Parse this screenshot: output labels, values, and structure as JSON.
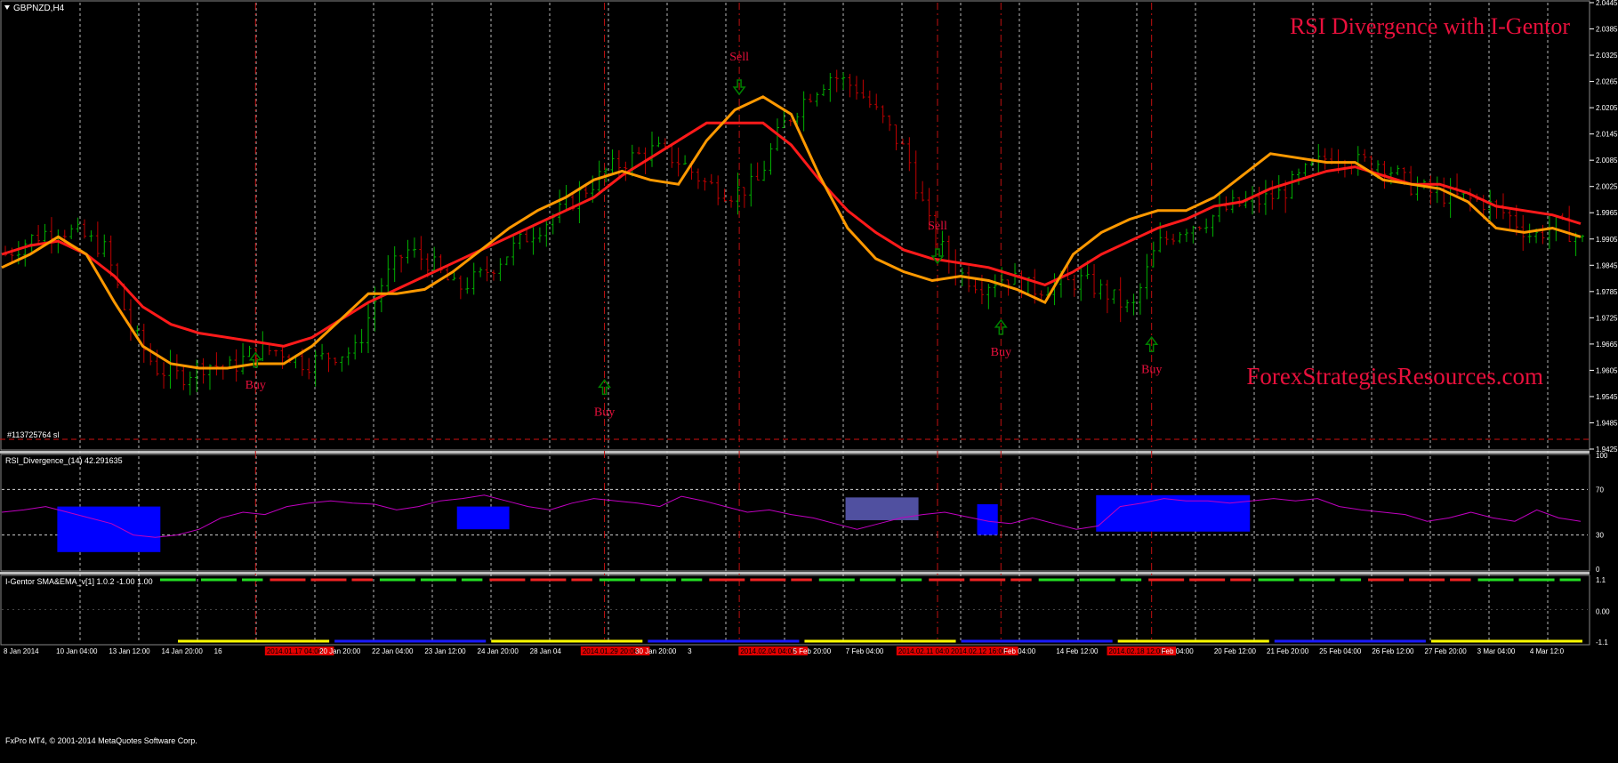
{
  "window": {
    "symbol_title": "GBPNZD,H4",
    "order_label": "#113725764 sl",
    "footer": "FxPro MT4, © 2001-2014 MetaQuotes Software Corp."
  },
  "overlay": {
    "title": "RSI Divergence with I-Gentor",
    "watermark": "ForexStrategiesResources.com"
  },
  "colors": {
    "background": "#000000",
    "bull_bar": "#00b000",
    "bear_bar": "#c00000",
    "fast_ma": "#ff9900",
    "slow_ma": "#ff1a1a",
    "rsi_line": "#c000c0",
    "signal_text": "#e8103c",
    "buy_arrow": "#008000",
    "divergence_box": "#0000ff",
    "selected_box": "#5050a0",
    "gentor_up": "#22dd22",
    "gentor_down": "#ee2222",
    "gentor_neutral": "#ffff00",
    "gentor_blue": "#1a1aff"
  },
  "chart_data": [
    {
      "type": "candlestick",
      "title": "GBPNZD,H4",
      "ylim": [
        1.9425,
        2.0445
      ],
      "y_ticks": [
        "2.0445",
        "2.0385",
        "2.0325",
        "2.0265",
        "2.0205",
        "2.0145",
        "2.0085",
        "2.0025",
        "1.9965",
        "1.9905",
        "1.9845",
        "1.9785",
        "1.9725",
        "1.9665",
        "1.9605",
        "1.9545",
        "1.9485",
        "1.9425"
      ],
      "x_ticks": [
        "8 Jan 2014",
        "10 Jan 04:00",
        "13 Jan 12:00",
        "14 Jan 20:00",
        "16",
        "2014.01.17 04:00",
        "20 Jan 20:00",
        "22 Jan 04:00",
        "23 Jan 12:00",
        "24 Jan 20:00",
        "28 Jan 04",
        "2014.01.29 20:00",
        "30 Jan 20:00",
        "3",
        "2014.02.04 04:00",
        "5 Feb 20:00",
        "7 Feb 04:00",
        "2014.02.11 04:00",
        "2014.02.12 16:00",
        "Feb 04:00",
        "14 Feb 12:00",
        "2014.02.18 12:00",
        "Feb 04:00",
        "20 Feb 12:00",
        "21 Feb 20:00",
        "25 Feb 04:00",
        "26 Feb 12:00",
        "27 Feb 20:00",
        "3 Mar 04:00",
        "4 Mar 12:0"
      ],
      "highlighted_x_ticks": [
        5,
        11,
        14,
        17,
        18,
        21
      ],
      "series": [
        {
          "name": "price",
          "values": [
            1.987,
            1.9905,
            1.993,
            1.9915,
            1.988,
            1.97,
            1.961,
            1.959,
            1.962,
            1.961,
            1.965,
            1.965,
            1.962,
            1.964,
            1.965,
            1.98,
            1.988,
            1.985,
            1.979,
            1.982,
            1.987,
            1.992,
            1.996,
            2.001,
            2.006,
            2.009,
            2.011,
            2.008,
            2.003,
            2.001,
            2.003,
            2.016,
            2.023,
            2.028,
            2.025,
            2.018,
            2.01,
            1.992,
            1.983,
            1.98,
            1.982,
            1.979,
            1.98,
            1.981,
            1.978,
            1.974,
            1.989,
            1.993,
            1.995,
            1.998,
            1.999,
            2.001,
            2.006,
            2.01,
            2.008,
            2.008,
            2.003,
            2.001,
            2.0,
            1.999,
            1.996,
            1.991,
            1.994,
            1.99
          ]
        },
        {
          "name": "ma_fast",
          "values": [
            1.984,
            1.987,
            1.991,
            1.987,
            1.976,
            1.966,
            1.962,
            1.961,
            1.961,
            1.962,
            1.962,
            1.966,
            1.972,
            1.978,
            1.978,
            1.979,
            1.983,
            1.988,
            1.993,
            1.997,
            2.0,
            2.004,
            2.006,
            2.004,
            2.003,
            2.013,
            2.02,
            2.023,
            2.019,
            2.005,
            1.993,
            1.986,
            1.983,
            1.981,
            1.982,
            1.981,
            1.979,
            1.976,
            1.987,
            1.992,
            1.995,
            1.997,
            1.997,
            2.0,
            2.005,
            2.01,
            2.009,
            2.008,
            2.008,
            2.004,
            2.003,
            2.002,
            1.999,
            1.993,
            1.992,
            1.993,
            1.991
          ]
        },
        {
          "name": "ma_slow",
          "values": [
            1.987,
            1.989,
            1.99,
            1.987,
            1.982,
            1.975,
            1.971,
            1.969,
            1.968,
            1.967,
            1.966,
            1.968,
            1.972,
            1.976,
            1.979,
            1.982,
            1.985,
            1.988,
            1.991,
            1.994,
            1.997,
            2.0,
            2.005,
            2.009,
            2.013,
            2.017,
            2.017,
            2.017,
            2.012,
            2.004,
            1.997,
            1.992,
            1.988,
            1.986,
            1.985,
            1.984,
            1.982,
            1.98,
            1.983,
            1.987,
            1.99,
            1.993,
            1.995,
            1.998,
            1.999,
            2.002,
            2.004,
            2.006,
            2.007,
            2.005,
            2.003,
            2.003,
            2.001,
            1.998,
            1.997,
            1.996,
            1.994
          ]
        }
      ],
      "signals": [
        {
          "label": "Buy",
          "x_frac": 0.16
        },
        {
          "label": "Buy",
          "x_frac": 0.38
        },
        {
          "label": "Sell",
          "x_frac": 0.465
        },
        {
          "label": "Sell",
          "x_frac": 0.59
        },
        {
          "label": "Buy",
          "x_frac": 0.63
        },
        {
          "label": "Buy",
          "x_frac": 0.725
        }
      ]
    },
    {
      "type": "line",
      "title": "RSI_Divergence_(14) 42.291635",
      "ylim": [
        0,
        100
      ],
      "y_ticks": [
        "100",
        "70",
        "30",
        "0"
      ],
      "levels": [
        70,
        30
      ],
      "series": [
        {
          "name": "RSI",
          "values": [
            50,
            52,
            55,
            50,
            45,
            40,
            30,
            28,
            30,
            35,
            45,
            50,
            48,
            55,
            58,
            60,
            58,
            57,
            52,
            55,
            60,
            62,
            65,
            60,
            55,
            52,
            58,
            62,
            60,
            58,
            55,
            64,
            60,
            55,
            50,
            52,
            48,
            45,
            40,
            35,
            40,
            45,
            48,
            50,
            46,
            42,
            40,
            45,
            40,
            35,
            38,
            55,
            58,
            62,
            60,
            60,
            58,
            60,
            62,
            60,
            62,
            55,
            52,
            50,
            48,
            42,
            45,
            50,
            45,
            42,
            52,
            45,
            42
          ]
        }
      ],
      "divergence_zones": [
        {
          "from": 0.035,
          "to": 0.1,
          "low": 15,
          "high": 55
        },
        {
          "from": 0.287,
          "to": 0.32,
          "low": 35,
          "high": 55
        },
        {
          "from": 0.532,
          "to": 0.578,
          "low": 43,
          "high": 63
        },
        {
          "from": 0.615,
          "to": 0.628,
          "low": 30,
          "high": 57
        },
        {
          "from": 0.69,
          "to": 0.787,
          "low": 33,
          "high": 65
        }
      ]
    },
    {
      "type": "bar",
      "title": "I-Gentor SMA&EMA_v[1] 1.0.2 -1.00 1.00",
      "ylim": [
        -1,
        1
      ],
      "y_ticks": [
        "1.1",
        "0.00",
        "-1.1"
      ]
    }
  ]
}
